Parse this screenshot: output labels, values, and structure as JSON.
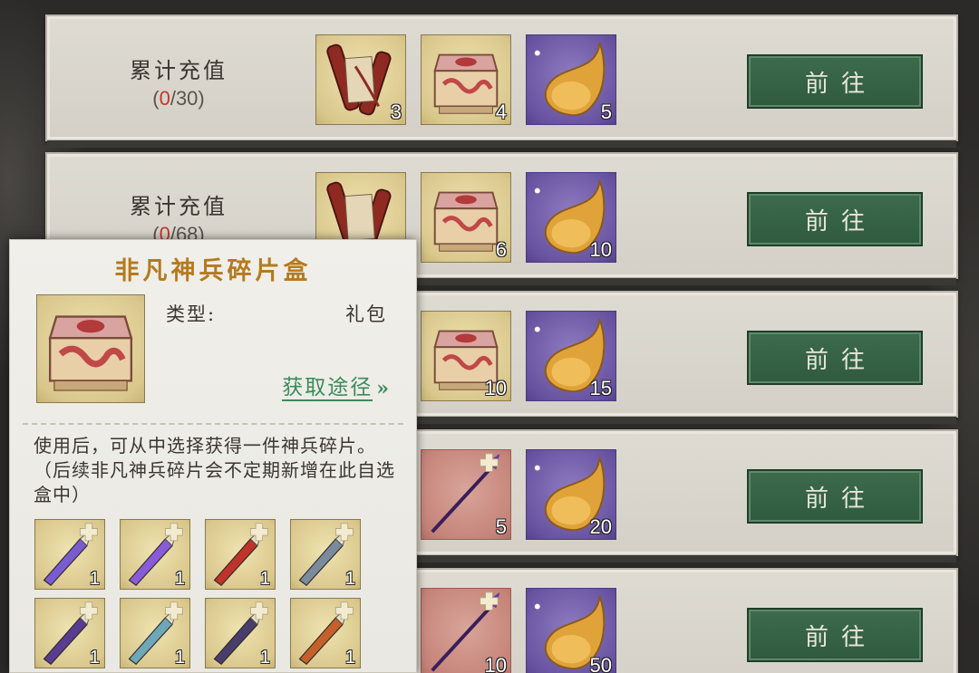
{
  "rows": [
    {
      "title": "累计充值",
      "progress_current": "0",
      "progress_total": "/30",
      "progress_open": "(",
      "progress_close": ")",
      "rewards": [
        {
          "icon": "scroll-icon",
          "qty": "3"
        },
        {
          "icon": "chest-icon",
          "qty": "4"
        },
        {
          "icon": "flame-orb-icon",
          "qty": "5"
        }
      ],
      "button": "前往"
    },
    {
      "title": "累计充值",
      "progress_current": "0",
      "progress_total": "/68",
      "progress_open": "(",
      "progress_close": ")",
      "rewards": [
        {
          "icon": "scroll-icon",
          "qty": ""
        },
        {
          "icon": "chest-icon",
          "qty": "6"
        },
        {
          "icon": "flame-orb-icon",
          "qty": "10"
        }
      ],
      "button": "前往"
    },
    {
      "title": "",
      "progress_current": "",
      "progress_total": "",
      "progress_open": "",
      "progress_close": "",
      "rewards": [
        {
          "icon": "chest-icon",
          "qty": "10"
        },
        {
          "icon": "flame-orb-icon",
          "qty": "15"
        }
      ],
      "button": "前往"
    },
    {
      "title": "",
      "progress_current": "",
      "progress_total": "",
      "progress_open": "",
      "progress_close": "",
      "rewards": [
        {
          "icon": "spear-fragment-icon",
          "qty": "5"
        },
        {
          "icon": "flame-orb-icon",
          "qty": "20"
        }
      ],
      "button": "前往"
    },
    {
      "title": "",
      "progress_current": "",
      "progress_total": "",
      "progress_open": "",
      "progress_close": "",
      "rewards": [
        {
          "icon": "spear-fragment-icon",
          "qty": "10"
        },
        {
          "icon": "flame-orb-icon",
          "qty": "50"
        }
      ],
      "button": "前往"
    }
  ],
  "popup": {
    "title": "非凡神兵碎片盒",
    "type_label": "类型:",
    "type_value": "礼包",
    "obtain_link": "获取途径",
    "obtain_arrow": "»",
    "description": "使用后，可从中选择获得一件神兵碎片。（后续非凡神兵碎片会不定期新增在此自选盒中）",
    "fragments": [
      {
        "icon": "axe-fragment-icon",
        "qty": "1",
        "accent": "#7a5bd0"
      },
      {
        "icon": "spear-fragment-icon",
        "qty": "1",
        "accent": "#8a5ad8"
      },
      {
        "icon": "blade-fragment-icon",
        "qty": "1",
        "accent": "#c0332a"
      },
      {
        "icon": "halberd-fragment-icon",
        "qty": "1",
        "accent": "#7c8a9e"
      },
      {
        "icon": "shield-fragment-icon",
        "qty": "1",
        "accent": "#5a3c90"
      },
      {
        "icon": "sword-fragment-icon",
        "qty": "1",
        "accent": "#6fa6b8"
      },
      {
        "icon": "dagger-fragment-icon",
        "qty": "1",
        "accent": "#4b3d6b"
      },
      {
        "icon": "staff-fragment-icon",
        "qty": "1",
        "accent": "#c4602a"
      }
    ]
  }
}
